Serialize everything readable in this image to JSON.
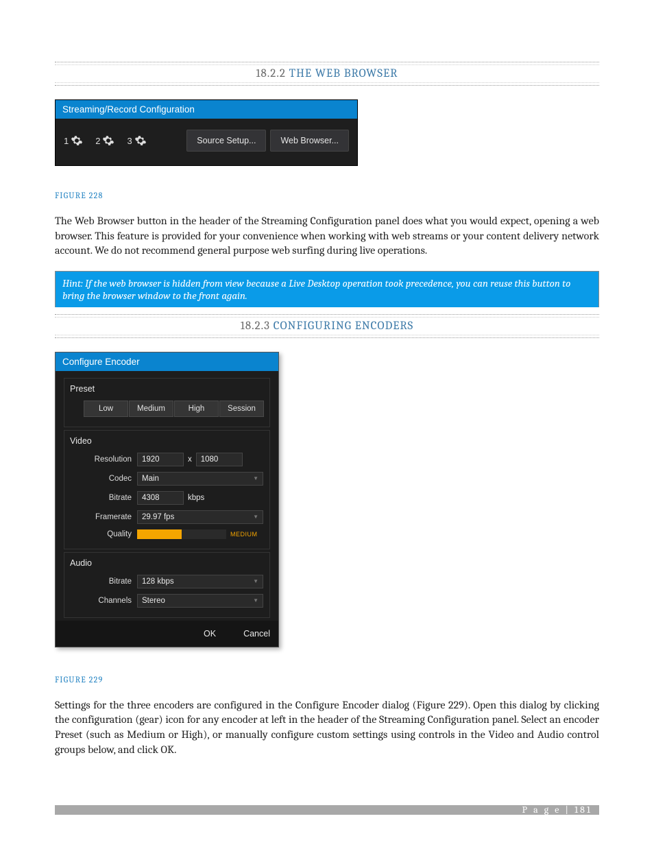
{
  "section1": {
    "number": "18.2.2",
    "title": "THE WEB BROWSER"
  },
  "panel1": {
    "title": "Streaming/Record Configuration",
    "items": [
      "1",
      "2",
      "3"
    ],
    "source_btn": "Source Setup...",
    "browser_btn": "Web Browser..."
  },
  "fig228": "FIGURE 228",
  "para1": "The Web Browser button in the header of the Streaming Configuration panel does what you would expect, opening a web browser. This feature is provided for your convenience when working with web streams or your content delivery network account. We do not recommend general purpose web surfing during live operations.",
  "hint": "Hint: If the web browser is hidden from view because a Live Desktop operation took precedence, you can reuse this button to bring the browser window to the front again.",
  "section2": {
    "number": "18.2.3",
    "title": "CONFIGURING ENCODERS"
  },
  "dialog": {
    "title": "Configure Encoder",
    "preset": {
      "label": "Preset",
      "buttons": [
        "Low",
        "Medium",
        "High",
        "Session"
      ]
    },
    "video": {
      "label": "Video",
      "resolution_label": "Resolution",
      "res_w": "1920",
      "res_sep": "x",
      "res_h": "1080",
      "codec_label": "Codec",
      "codec_val": "Main",
      "bitrate_label": "Bitrate",
      "bitrate_val": "4308",
      "bitrate_unit": "kbps",
      "framerate_label": "Framerate",
      "framerate_val": "29.97 fps",
      "quality_label": "Quality",
      "quality_val": "MEDIUM"
    },
    "audio": {
      "label": "Audio",
      "bitrate_label": "Bitrate",
      "bitrate_val": "128 kbps",
      "channels_label": "Channels",
      "channels_val": "Stereo"
    },
    "ok": "OK",
    "cancel": "Cancel"
  },
  "fig229": "FIGURE 229",
  "para2": "Settings for the three encoders are configured in the Configure Encoder dialog (Figure 229).  Open this dialog by clicking the configuration (gear) icon for any encoder at left in the header of the Streaming Configuration panel.  Select an encoder Preset (such as Medium or High), or manually configure custom settings using controls in the Video and Audio control groups below, and click OK.",
  "footer": {
    "label": "P a g e",
    "sep": "|",
    "num": "181"
  }
}
